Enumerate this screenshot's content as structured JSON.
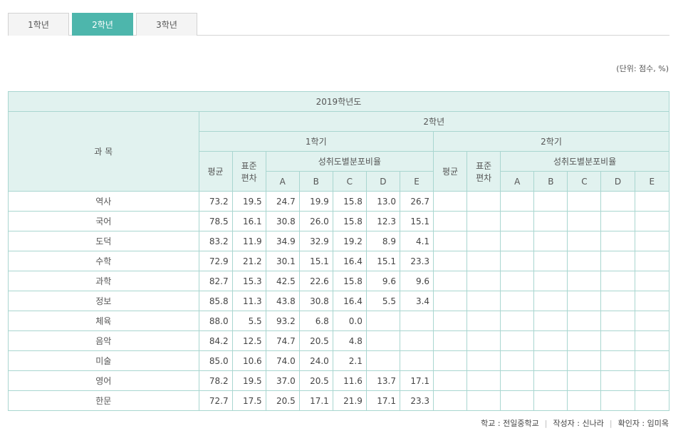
{
  "tabs": [
    {
      "label": "1학년",
      "active": false
    },
    {
      "label": "2학년",
      "active": true
    },
    {
      "label": "3학년",
      "active": false
    }
  ],
  "unit_note": "(단위: 점수, %)",
  "table": {
    "year_header": "2019학년도",
    "subject_header": "과 목",
    "grade_header": "2학년",
    "semesters": [
      "1학기",
      "2학기"
    ],
    "avg_header": "평균",
    "std_header_line1": "표준",
    "std_header_line2": "편차",
    "dist_header": "성취도별분포비율",
    "levels": [
      "A",
      "B",
      "C",
      "D",
      "E"
    ],
    "rows": [
      {
        "subject": "역사",
        "s1": [
          "73.2",
          "19.5",
          "24.7",
          "19.9",
          "15.8",
          "13.0",
          "26.7"
        ]
      },
      {
        "subject": "국어",
        "s1": [
          "78.5",
          "16.1",
          "30.8",
          "26.0",
          "15.8",
          "12.3",
          "15.1"
        ]
      },
      {
        "subject": "도덕",
        "s1": [
          "83.2",
          "11.9",
          "34.9",
          "32.9",
          "19.2",
          "8.9",
          "4.1"
        ]
      },
      {
        "subject": "수학",
        "s1": [
          "72.9",
          "21.2",
          "30.1",
          "15.1",
          "16.4",
          "15.1",
          "23.3"
        ]
      },
      {
        "subject": "과학",
        "s1": [
          "82.7",
          "15.3",
          "42.5",
          "22.6",
          "15.8",
          "9.6",
          "9.6"
        ]
      },
      {
        "subject": "정보",
        "s1": [
          "85.8",
          "11.3",
          "43.8",
          "30.8",
          "16.4",
          "5.5",
          "3.4"
        ]
      },
      {
        "subject": "체육",
        "s1": [
          "88.0",
          "5.5",
          "93.2",
          "6.8",
          "0.0",
          "",
          ""
        ]
      },
      {
        "subject": "음악",
        "s1": [
          "84.2",
          "12.5",
          "74.7",
          "20.5",
          "4.8",
          "",
          ""
        ]
      },
      {
        "subject": "미술",
        "s1": [
          "85.0",
          "10.6",
          "74.0",
          "24.0",
          "2.1",
          "",
          ""
        ]
      },
      {
        "subject": "영어",
        "s1": [
          "78.2",
          "19.5",
          "37.0",
          "20.5",
          "11.6",
          "13.7",
          "17.1"
        ]
      },
      {
        "subject": "한문",
        "s1": [
          "72.7",
          "17.5",
          "20.5",
          "17.1",
          "21.9",
          "17.1",
          "23.3"
        ]
      }
    ]
  },
  "footer": {
    "school": "학교 : 전일중학교",
    "writer": "작성자 : 신나라",
    "checker": "확인자 : 임미옥"
  }
}
